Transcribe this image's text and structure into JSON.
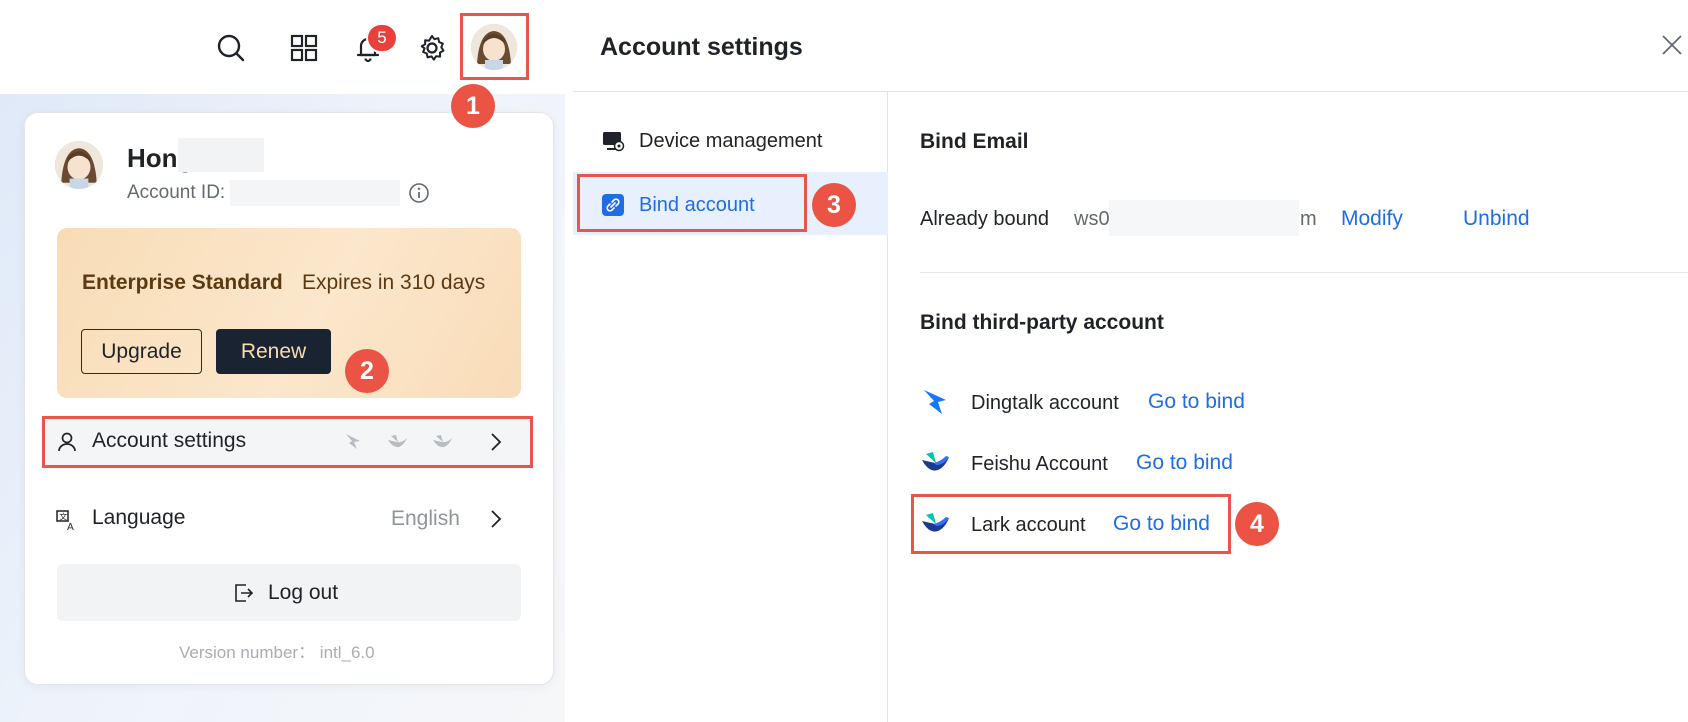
{
  "topbar": {
    "notification_count": "5"
  },
  "profile": {
    "name": "Hong",
    "account_id_label": "Account ID:"
  },
  "plan": {
    "name": "Enterprise Standard",
    "expires": "Expires in 310 days",
    "upgrade_label": "Upgrade",
    "renew_label": "Renew"
  },
  "menu": {
    "account_settings": "Account settings",
    "language_label": "Language",
    "language_value": "English",
    "logout_label": "Log out",
    "version": "Version number：  intl_6.0"
  },
  "markers": [
    "1",
    "2",
    "3",
    "4"
  ],
  "settings": {
    "title": "Account settings",
    "nav": [
      {
        "label": "Device management"
      },
      {
        "label": "Bind account"
      }
    ],
    "bind_email": {
      "title": "Bind Email",
      "status": "Already bound",
      "email_prefix": "ws0",
      "email_suffix": "m",
      "modify": "Modify",
      "unbind": "Unbind"
    },
    "third_party": {
      "title": "Bind third-party account",
      "accounts": [
        {
          "name": "Dingtalk account",
          "action": "Go to bind",
          "icon": "dingtalk-icon"
        },
        {
          "name": "Feishu Account",
          "action": "Go to bind",
          "icon": "feishu-icon"
        },
        {
          "name": "Lark account",
          "action": "Go to bind",
          "icon": "lark-icon"
        }
      ]
    }
  },
  "colors": {
    "accent_blue": "#1f6de6",
    "highlight_red": "#e8564b",
    "marker_red": "#eb5445",
    "nav_active_bg": "#e9f0fd",
    "renew_bg": "#1a2332"
  }
}
